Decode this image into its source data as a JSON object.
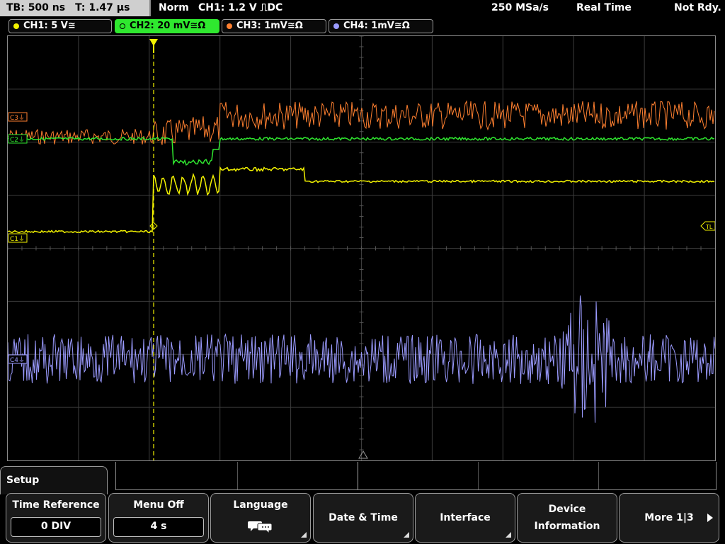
{
  "topbar": {
    "timebase": "TB: 500 ns",
    "trigger_time": "T: 1.47 µs",
    "mode": "Norm",
    "trigger_source": "CH1: 1.2 V ⎍DC",
    "sample_rate": "250 MSa/s",
    "acq_mode": "Real Time",
    "status": "Not Rdy."
  },
  "channels": [
    {
      "label": "CH1: 5 V≅",
      "color": "#f2f200",
      "active": false
    },
    {
      "label": "CH2: 20 mV≅Ω",
      "color": "#2fe82f",
      "active": true
    },
    {
      "label": "CH3: 1mV≅Ω",
      "color": "#ff8030",
      "active": false
    },
    {
      "label": "CH4: 1mV≅Ω",
      "color": "#9b9bff",
      "active": false
    }
  ],
  "markers": {
    "trigger_level": "TL",
    "c1": "C1⏚",
    "c2": "C2⏚",
    "c3": "C3⏚",
    "c4": "C4⏚",
    "trigger_pos": "T"
  },
  "colors": {
    "ch1": "#f2f200",
    "ch2": "#2fe82f",
    "ch3": "#ff8030",
    "ch4": "#9b9bff",
    "grid": "#3c3c3c"
  },
  "menu": {
    "title": "Setup",
    "softkeys": [
      {
        "label": "Time Reference",
        "value": "0 DIV"
      },
      {
        "label": "Menu Off",
        "value": "4 s"
      },
      {
        "label": "Language",
        "icon": "speech-bubbles-icon"
      },
      {
        "label": "Date & Time"
      },
      {
        "label": "Interface"
      },
      {
        "label": "Device",
        "label2": "Information"
      },
      {
        "label": "More 1|3"
      }
    ]
  }
}
